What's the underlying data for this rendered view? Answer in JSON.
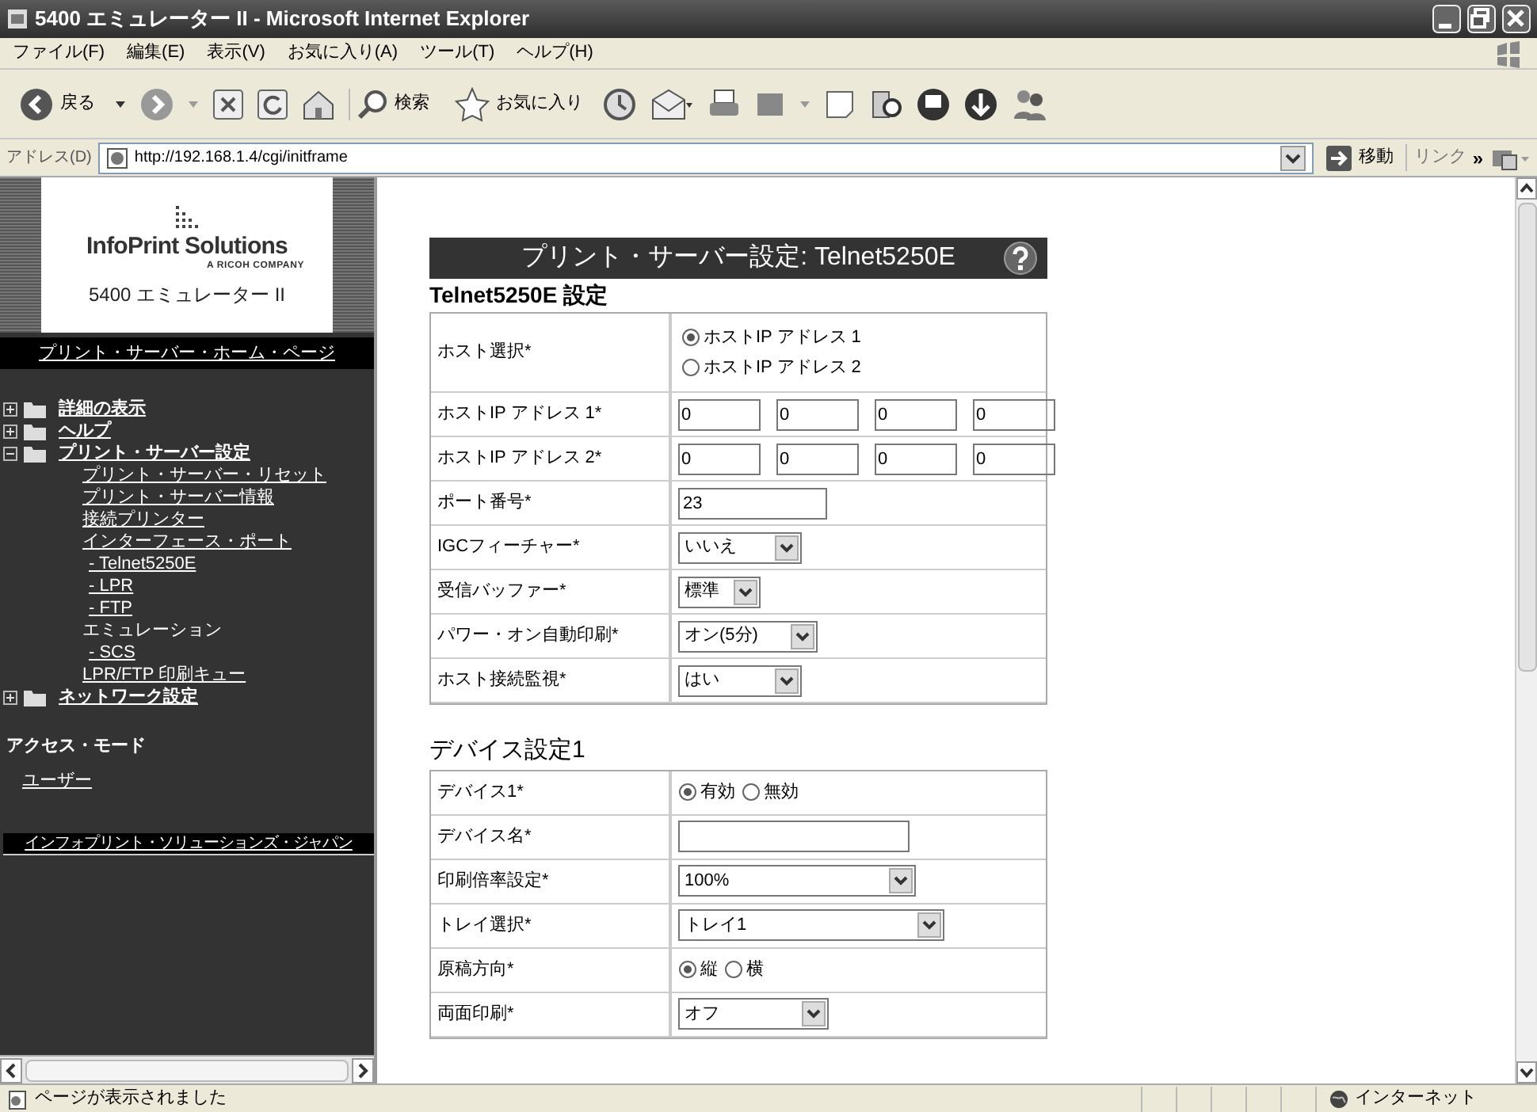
{
  "window": {
    "title": "5400 エミュレーター II - Microsoft Internet Explorer"
  },
  "menu": [
    "ファイル(F)",
    "編集(E)",
    "表示(V)",
    "お気に入り(A)",
    "ツール(T)",
    "ヘルプ(H)"
  ],
  "toolbar": {
    "back": "戻る",
    "search": "検索",
    "favorites": "お気に入り"
  },
  "address_bar": {
    "label": "アドレス(D)",
    "url": "http://192.168.1.4/cgi/initframe",
    "go": "移動",
    "links": "リンク",
    "more": "»"
  },
  "sidebar": {
    "logo": {
      "brand": "InfoPrint Solutions",
      "tagline": "A RICOH COMPANY",
      "product": "5400 エミュレーター II"
    },
    "home_link": "プリント・サーバー・ホーム・ページ",
    "tree": [
      {
        "label": "詳細の表示",
        "expanded": false
      },
      {
        "label": "ヘルプ",
        "expanded": false
      },
      {
        "label": "プリント・サーバー設定",
        "expanded": true,
        "children": [
          {
            "label": "プリント・サーバー・リセット",
            "link": true
          },
          {
            "label": "プリント・サーバー情報",
            "link": true
          },
          {
            "label": "接続プリンター",
            "link": true
          },
          {
            "label": "インターフェース・ポート",
            "link": true,
            "children": [
              {
                "label": "- Telnet5250E",
                "link": true
              },
              {
                "label": "- LPR",
                "link": true
              },
              {
                "label": "- FTP",
                "link": true
              }
            ]
          },
          {
            "label": "エミュレーション",
            "link": false,
            "children": [
              {
                "label": "- SCS",
                "link": true
              }
            ]
          },
          {
            "label": "LPR/FTP 印刷キュー",
            "link": true
          }
        ]
      },
      {
        "label": "ネットワーク設定",
        "expanded": false
      }
    ],
    "access_mode": {
      "heading": "アクセス・モード",
      "link": "ユーザー"
    },
    "footer_link": "インフォプリント・ソリューションズ・ジャパン"
  },
  "page": {
    "title": "プリント・サーバー設定: Telnet5250E",
    "sections": [
      {
        "title": "Telnet5250E 設定",
        "rows": [
          {
            "kind": "radio_list",
            "label": "ホスト選択*",
            "options": [
              {
                "label": "ホストIP アドレス 1",
                "selected": true
              },
              {
                "label": "ホストIP アドレス 2",
                "selected": false
              }
            ]
          },
          {
            "kind": "ip",
            "label": "ホストIP アドレス 1*",
            "octets": [
              "0",
              "0",
              "0",
              "0"
            ]
          },
          {
            "kind": "ip",
            "label": "ホストIP アドレス 2*",
            "octets": [
              "0",
              "0",
              "0",
              "0"
            ]
          },
          {
            "kind": "text",
            "label": "ポート番号*",
            "value": "23"
          },
          {
            "kind": "select",
            "label": "IGCフィーチャー*",
            "value": "いいえ"
          },
          {
            "kind": "select",
            "label": "受信バッファー*",
            "value": "標準"
          },
          {
            "kind": "select",
            "label": "パワー・オン自動印刷*",
            "value": "オン(5分)"
          },
          {
            "kind": "select",
            "label": "ホスト接続監視*",
            "value": "はい"
          }
        ]
      },
      {
        "title": "デバイス設定1",
        "rows": [
          {
            "kind": "radio_row",
            "label": "デバイス1*",
            "options": [
              {
                "label": "有効",
                "selected": true
              },
              {
                "label": "無効",
                "selected": false
              }
            ]
          },
          {
            "kind": "text",
            "label": "デバイス名*"
          },
          {
            "kind": "select",
            "label": "印刷倍率設定*",
            "value": "100%"
          },
          {
            "kind": "select",
            "label": "トレイ選択*",
            "value": "トレイ1"
          },
          {
            "kind": "radio_row",
            "label": "原稿方向*",
            "options": [
              {
                "label": "縦",
                "selected": true
              },
              {
                "label": "横",
                "selected": false
              }
            ]
          },
          {
            "kind": "select",
            "label": "両面印刷*",
            "value": "オフ"
          }
        ]
      }
    ]
  },
  "status_bar": {
    "message": "ページが表示されました",
    "zone": "インターネット"
  }
}
